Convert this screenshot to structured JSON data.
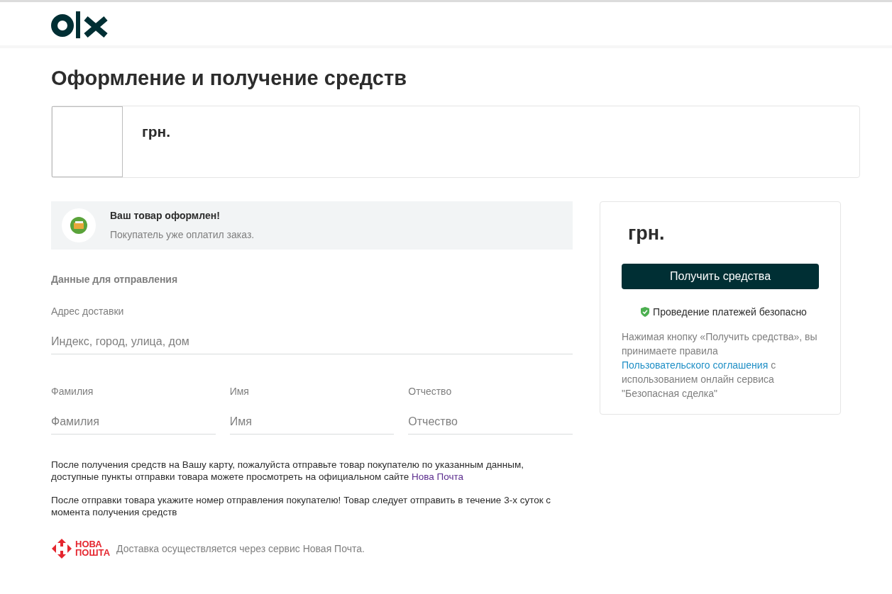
{
  "page_title": "Оформление и получение средств",
  "product": {
    "price": "грн."
  },
  "notice": {
    "title": "Ваш товар оформлен!",
    "text": "Покупатель уже оплатил заказ."
  },
  "shipping": {
    "heading": "Данные для отправления",
    "address": {
      "label": "Адрес доставки",
      "placeholder": "Индекс, город, улица, дом"
    },
    "fields": [
      {
        "label": "Фамилия",
        "placeholder": "Фамилия"
      },
      {
        "label": "Имя",
        "placeholder": "Имя"
      },
      {
        "label": "Отчество",
        "placeholder": "Отчество"
      }
    ]
  },
  "info": [
    {
      "text": "После получения средств на Вашу карту, пожалуйста отправьте товар покупателю по указанным данным, доступные пункты отправки товара можете просмотреть на официальном сайте",
      "link": "Нова Почта"
    },
    {
      "text": "После отправки товара укажите номер отправления покупателю! Товар следует отправить в течение 3-х суток с момента получения средств"
    }
  ],
  "delivery": {
    "logo_line_1": "НОВА",
    "logo_line_2": "ПОШТА",
    "text": "Доставка осуществляется через сервис Новая Почта."
  },
  "sidebar": {
    "price": "грн.",
    "button": "Получить средства",
    "secure": "Проведение платежей безопасно",
    "terms_before": "Нажимая кнопку «Получить средства», вы принимаете правила",
    "terms_link": "Пользовательского соглашения",
    "terms_after": "с использованием онлайн сервиса \"Безопасная сделка\""
  }
}
